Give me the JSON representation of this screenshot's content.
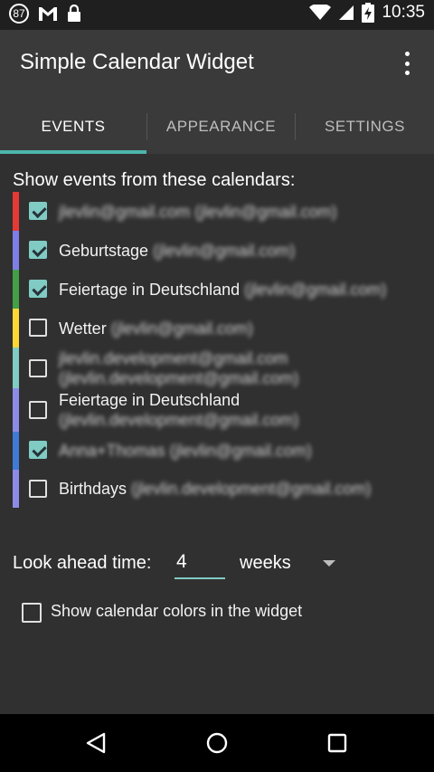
{
  "status_bar": {
    "notification_count": "87",
    "time": "10:35",
    "icons": [
      "notification-count-icon",
      "gmail-icon",
      "lock-icon",
      "wifi-icon",
      "cell-signal-icon",
      "battery-charging-icon"
    ]
  },
  "app_bar": {
    "title": "Simple Calendar Widget",
    "overflow_icon": "more-vert-icon"
  },
  "tabs": [
    {
      "label": "EVENTS",
      "active": true
    },
    {
      "label": "APPEARANCE",
      "active": false
    },
    {
      "label": "SETTINGS",
      "active": false
    }
  ],
  "section_title": "Show events from these calendars:",
  "calendars": [
    {
      "name": "",
      "account": "jlevlin@gmail.com (jlevlin@gmail.com)",
      "checked": true,
      "color": "#e53935"
    },
    {
      "name": "Geburtstage",
      "account": "(jlevlin@gmail.com)",
      "checked": true,
      "color": "#7e7ee6"
    },
    {
      "name": "Feiertage in Deutschland",
      "account": "(jlevlin@gmail.com)",
      "checked": true,
      "color": "#43a047"
    },
    {
      "name": "Wetter",
      "account": "(jlevlin@gmail.com)",
      "checked": false,
      "color": "#fdd835"
    },
    {
      "name": "",
      "account": "jlevlin.development@gmail.com",
      "account2": "(jlevlin.development@gmail.com)",
      "checked": false,
      "color": "#80cbc4"
    },
    {
      "name": "Feiertage in Deutschland",
      "account": "",
      "account2": "(jlevlin.development@gmail.com)",
      "checked": false,
      "color": "#8c8ce8"
    },
    {
      "name": "",
      "account": "Anna+Thomas (jlevlin@gmail.com)",
      "checked": true,
      "color": "#3f7bd6"
    },
    {
      "name": "Birthdays",
      "account": "(jlevlin.development@gmail.com)",
      "checked": false,
      "color": "#8c8ce8"
    }
  ],
  "lookahead": {
    "label": "Look ahead time:",
    "value": "4",
    "unit": "weeks"
  },
  "show_colors": {
    "label": "Show calendar colors in the widget",
    "checked": false
  },
  "nav_bar": {
    "icons": [
      "back-icon",
      "home-icon",
      "recents-icon"
    ]
  }
}
